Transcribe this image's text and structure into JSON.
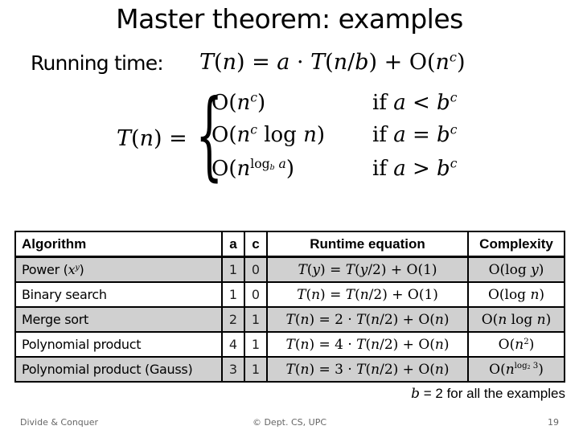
{
  "slide": {
    "title": "Master theorem: examples",
    "running_time_label": "Running time:",
    "recurrence": "T(n) = a · T(n/b) + O(n^c)",
    "piecewise": {
      "lhs": "T(n) =",
      "cases": [
        {
          "result": "O(n^c)",
          "condition": "if a < b^c"
        },
        {
          "result": "O(n^c log n)",
          "condition": "if a = b^c"
        },
        {
          "result": "O(n^(log_b a))",
          "condition": "if a > b^c"
        }
      ]
    }
  },
  "table": {
    "headers": [
      "Algorithm",
      "a",
      "c",
      "Runtime equation",
      "Complexity"
    ],
    "rows": [
      {
        "algorithm": "Power (x^y)",
        "a": "1",
        "c": "0",
        "equation": "T(y) = T(y/2) + O(1)",
        "complexity": "O(log y)",
        "shaded": true
      },
      {
        "algorithm": "Binary search",
        "a": "1",
        "c": "0",
        "equation": "T(n) = T(n/2) + O(1)",
        "complexity": "O(log n)",
        "shaded": false
      },
      {
        "algorithm": "Merge sort",
        "a": "2",
        "c": "1",
        "equation": "T(n) = 2 · T(n/2) + O(n)",
        "complexity": "O(n log n)",
        "shaded": true
      },
      {
        "algorithm": "Polynomial product",
        "a": "4",
        "c": "1",
        "equation": "T(n) = 4 · T(n/2) + O(n)",
        "complexity": "O(n^2)",
        "shaded": false
      },
      {
        "algorithm": "Polynomial product (Gauss)",
        "a": "3",
        "c": "1",
        "equation": "T(n) = 3 · T(n/2) + O(n)",
        "complexity": "O(n^(log_2 3))",
        "shaded": true
      }
    ]
  },
  "note": {
    "var": "b",
    "text": " = 2 for all the examples"
  },
  "footer": {
    "left": "Divide & Conquer",
    "center": "© Dept. CS, UPC",
    "page": "19"
  },
  "colors": {
    "shaded_row": "#d0d0d0",
    "footer_text": "#666666"
  }
}
